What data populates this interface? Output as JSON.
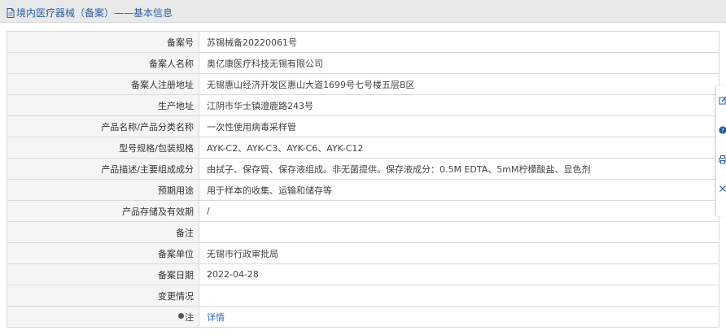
{
  "header": {
    "title": "境内医疗器械（备案）——基本信息"
  },
  "rows": [
    {
      "label": "备案号",
      "value": "苏锡械备20220061号"
    },
    {
      "label": "备案人名称",
      "value": "奥亿康医疗科技无锡有限公司"
    },
    {
      "label": "备案人注册地址",
      "value": "无锡惠山经济开发区惠山大道1699号七号楼五层B区"
    },
    {
      "label": "生产地址",
      "value": "江阴市华士镇澄鹿路243号"
    },
    {
      "label": "产品名称/产品分类名称",
      "value": "一次性使用病毒采样管"
    },
    {
      "label": "型号规格/包装规格",
      "value": "AYK-C2、AYK-C3、AYK-C6、AYK-C12"
    },
    {
      "label": "产品描述/主要组成成分",
      "value": "由拭子、保存管、保存液组成。非无菌提供。保存液成分：0.5M EDTA、5mM柠檬酸盐、显色剂"
    },
    {
      "label": "预期用途",
      "value": "用于样本的收集、运输和储存等"
    },
    {
      "label": "产品存储及有效期",
      "value": "/"
    },
    {
      "label": "备注",
      "value": ""
    },
    {
      "label": "备案单位",
      "value": "无锡市行政审批局"
    },
    {
      "label": "备案日期",
      "value": "2022-04-28"
    },
    {
      "label": "变更情况",
      "value": ""
    },
    {
      "label": "注",
      "value": "详情"
    }
  ],
  "icons": {
    "header": "document-icon",
    "note": "pin-icon",
    "toolbar": [
      "edit-icon",
      "help-icon",
      "print-icon",
      "close-icon"
    ]
  },
  "colors": {
    "header_text": "#2a5d9f",
    "link": "#2a6fc9",
    "label_bg": "#f5f5f5",
    "border": "#d9d9d9"
  }
}
